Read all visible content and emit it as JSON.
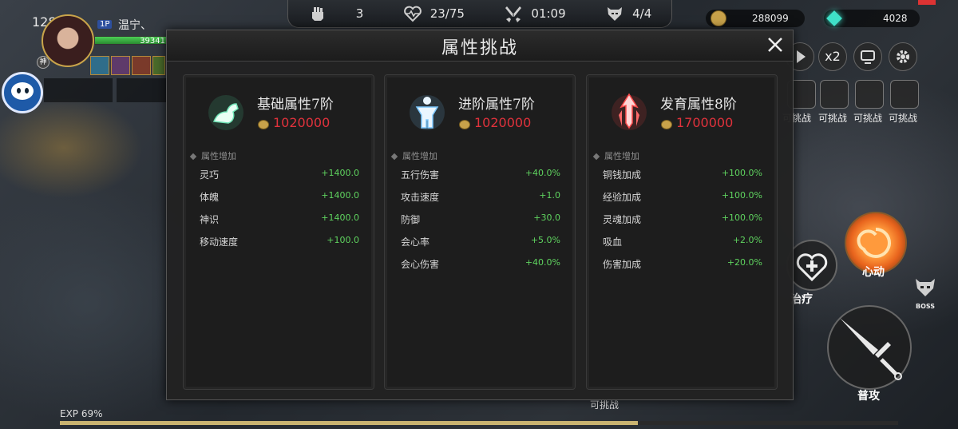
{
  "player": {
    "level": "128",
    "name": "温宁、",
    "slot_badge": "1P",
    "hp_value": "39341",
    "class_badge": "神"
  },
  "top_hud": {
    "power": "3",
    "health": "23/75",
    "timer": "01:09",
    "boss_count": "4/4"
  },
  "currency": {
    "coins": "288099",
    "gems": "4028"
  },
  "side_controls": {
    "speed_label": "x2"
  },
  "challenge_slots": [
    "可挑战",
    "可挑战",
    "可挑战",
    "可挑战"
  ],
  "modal": {
    "title": "属性挑战",
    "cards": [
      {
        "name": "基础属性7阶",
        "cost": "1020000",
        "section_title": "属性增加",
        "icon": "arm-muscle-icon",
        "rows": [
          {
            "label": "灵巧",
            "value": "+1400.0"
          },
          {
            "label": "体魄",
            "value": "+1400.0"
          },
          {
            "label": "神识",
            "value": "+1400.0"
          },
          {
            "label": "移动速度",
            "value": "+100.0"
          }
        ]
      },
      {
        "name": "进阶属性7阶",
        "cost": "1020000",
        "section_title": "属性增加",
        "icon": "body-icon",
        "rows": [
          {
            "label": "五行伤害",
            "value": "+40.0%"
          },
          {
            "label": "攻击速度",
            "value": "+1.0"
          },
          {
            "label": "防御",
            "value": "+30.0"
          },
          {
            "label": "会心率",
            "value": "+5.0%"
          },
          {
            "label": "会心伤害",
            "value": "+40.0%"
          }
        ]
      },
      {
        "name": "发育属性8阶",
        "cost": "1700000",
        "section_title": "属性增加",
        "icon": "arrow-up-icon",
        "rows": [
          {
            "label": "铜钱加成",
            "value": "+100.0%"
          },
          {
            "label": "经验加成",
            "value": "+100.0%"
          },
          {
            "label": "灵魂加成",
            "value": "+100.0%"
          },
          {
            "label": "吸血",
            "value": "+2.0%"
          },
          {
            "label": "伤害加成",
            "value": "+20.0%"
          }
        ]
      }
    ]
  },
  "actions": {
    "heal_label": "治疗",
    "heartbeat_label": "心动",
    "boss_label": "BOSS",
    "attack_label": "普攻"
  },
  "bottom_challenge_label": "可挑战",
  "exp": {
    "label": "EXP 69%",
    "progress": 0.69
  },
  "colors": {
    "cost_red": "#e0323c",
    "bonus_green": "#5fd35f",
    "exp_bar": "#c9b370"
  }
}
